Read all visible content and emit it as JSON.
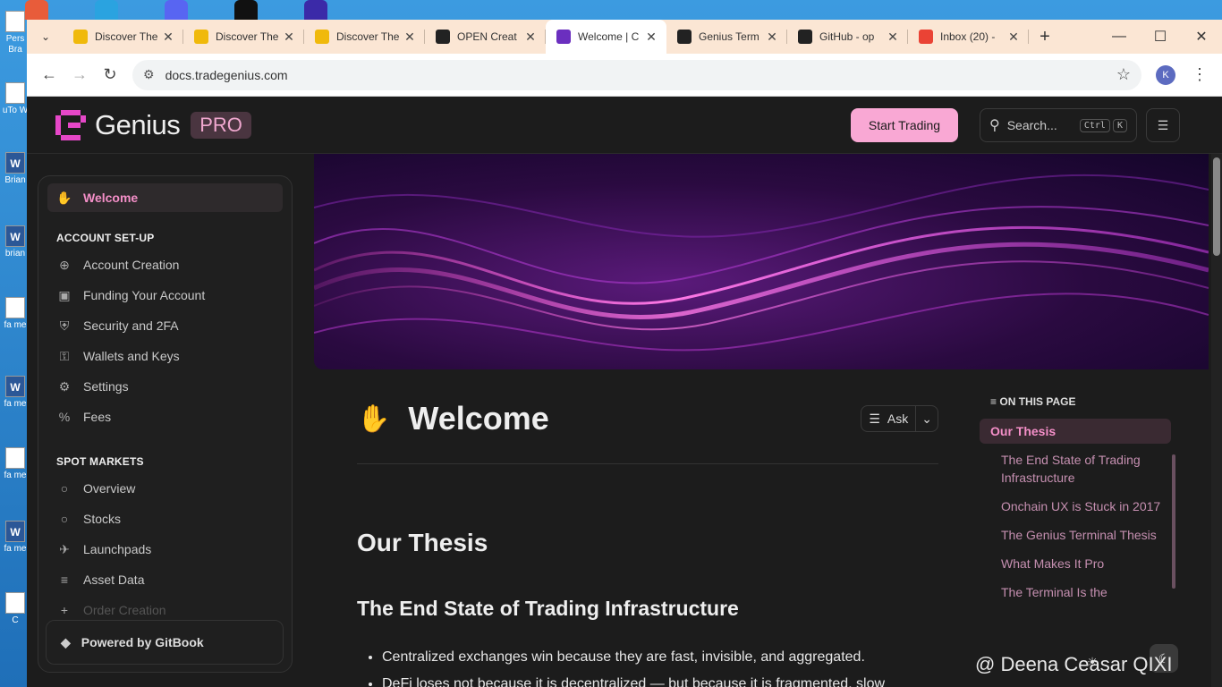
{
  "desktop": {
    "icons": [
      {
        "label": "Pers Bra",
        "type": "doc"
      },
      {
        "label": "uTo W",
        "type": "app"
      },
      {
        "label": "Brian",
        "type": "word"
      },
      {
        "label": "brian",
        "type": "word"
      },
      {
        "label": "fa me",
        "type": "doc"
      },
      {
        "label": "fa me",
        "type": "word"
      },
      {
        "label": "fa me",
        "type": "doc"
      },
      {
        "label": "fa me",
        "type": "word"
      },
      {
        "label": "C",
        "type": "app"
      }
    ]
  },
  "browser": {
    "tabs": [
      {
        "label": "Discover The",
        "favicon": "binance-icon",
        "color": "#f0b90b"
      },
      {
        "label": "Discover The",
        "favicon": "binance-icon",
        "color": "#f0b90b"
      },
      {
        "label": "Discover The",
        "favicon": "binance-icon",
        "color": "#f0b90b"
      },
      {
        "label": "OPEN Creat",
        "favicon": "notion-icon",
        "color": "#222222"
      },
      {
        "label": "Welcome | C",
        "favicon": "genius-icon",
        "color": "#6b2fbf",
        "active": true
      },
      {
        "label": "Genius Term",
        "favicon": "genius-terminal-icon",
        "color": "#222222"
      },
      {
        "label": "GitHub - op",
        "favicon": "github-icon",
        "color": "#222222"
      },
      {
        "label": "Inbox (20) -",
        "favicon": "gmail-icon",
        "color": "#ea4335"
      }
    ],
    "new_tab": "+",
    "url": "docs.tradegenius.com",
    "profile_initial": "K"
  },
  "site": {
    "brand": "Genius",
    "badge": "PRO",
    "start_trading": "Start Trading",
    "search_placeholder": "Search...",
    "kbd_ctrl": "Ctrl",
    "kbd_k": "K",
    "accent": "#f9a8d4"
  },
  "sidebar": {
    "welcome": "Welcome",
    "sections": [
      {
        "heading": "ACCOUNT SET-UP",
        "items": [
          {
            "label": "Account Creation",
            "icon": "plus-circle-icon"
          },
          {
            "label": "Funding Your Account",
            "icon": "wallet-icon"
          },
          {
            "label": "Security and 2FA",
            "icon": "shield-icon"
          },
          {
            "label": "Wallets and Keys",
            "icon": "key-icon"
          },
          {
            "label": "Settings",
            "icon": "gear-icon"
          },
          {
            "label": "Fees",
            "icon": "percent-icon"
          }
        ]
      },
      {
        "heading": "SPOT MARKETS",
        "items": [
          {
            "label": "Overview",
            "icon": "circle-icon"
          },
          {
            "label": "Stocks",
            "icon": "circle-icon"
          },
          {
            "label": "Launchpads",
            "icon": "rocket-icon"
          },
          {
            "label": "Asset Data",
            "icon": "database-icon"
          },
          {
            "label": "Order Creation",
            "icon": "plus-icon"
          }
        ]
      }
    ],
    "powered_by": "Powered by GitBook"
  },
  "main": {
    "title": "Welcome",
    "ask": "Ask",
    "h1": "Our Thesis",
    "h2": "The End State of Trading Infrastructure",
    "bullets": [
      "Centralized exchanges win because they are fast, invisible, and aggregated.",
      "DeFi loses not because it is decentralized — but because it is fragmented, slow"
    ]
  },
  "toc": {
    "heading": "ON THIS PAGE",
    "items": [
      {
        "label": "Our Thesis",
        "active": true
      },
      {
        "label": "The End State of Trading Infrastructure"
      },
      {
        "label": "Onchain UX is Stuck in 2017"
      },
      {
        "label": "The Genius Terminal Thesis"
      },
      {
        "label": "What Makes It Pro"
      },
      {
        "label": "The Terminal Is the"
      }
    ]
  },
  "watermark": "@ Deena Ceasar QIXI"
}
